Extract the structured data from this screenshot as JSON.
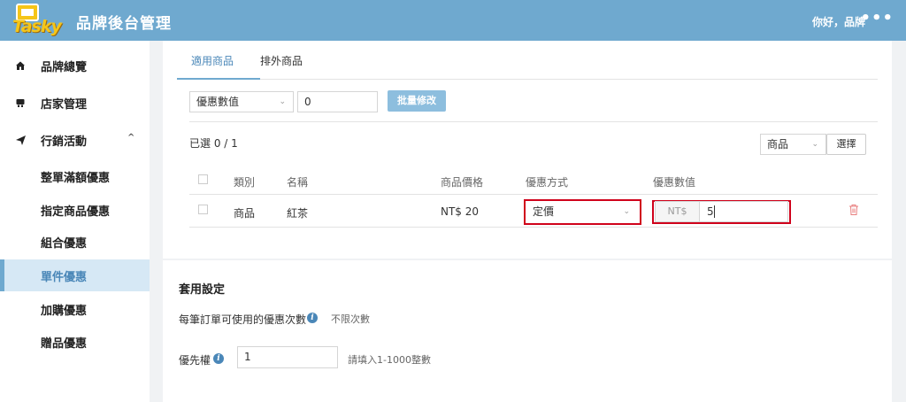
{
  "header": {
    "logo_text": "Tasky",
    "title": "品牌後台管理",
    "greeting": "你好，品牌",
    "more_label": "•••"
  },
  "sidebar": {
    "items": [
      {
        "label": "品牌總覽",
        "icon": "home-icon"
      },
      {
        "label": "店家管理",
        "icon": "store-icon"
      },
      {
        "label": "行銷活動",
        "icon": "send-icon",
        "expanded": true,
        "chevron": "^"
      },
      {
        "label": "整單滿額優惠"
      },
      {
        "label": "指定商品優惠"
      },
      {
        "label": "組合優惠"
      },
      {
        "label": "單件優惠",
        "active": true
      },
      {
        "label": "加購優惠"
      },
      {
        "label": "贈品優惠"
      }
    ]
  },
  "tabs": [
    {
      "label": "適用商品",
      "active": true
    },
    {
      "label": "排外商品"
    }
  ],
  "bulk": {
    "type_select": "優惠數值",
    "value_input": "0",
    "apply_button": "批量修改"
  },
  "selection": {
    "count_text": "已選 0 / 1",
    "filter_select": "商品",
    "choose_button": "選擇"
  },
  "table": {
    "columns": [
      "類別",
      "名稱",
      "商品價格",
      "優惠方式",
      "優惠數值"
    ],
    "rows": [
      {
        "category": "商品",
        "name": "紅茶",
        "price": "NT$ 20",
        "method": "定價",
        "value_prefix": "NT$",
        "value": "5"
      }
    ]
  },
  "settings": {
    "title": "套用設定",
    "usage_label": "每筆訂單可使用的優惠次數",
    "usage_value": "不限次數",
    "priority_label": "優先權",
    "priority_value": "1",
    "priority_hint": "請填入1-1000整數"
  },
  "colors": {
    "header_bg": "#6fa9cf",
    "accent": "#4a87b8",
    "highlight_frame": "#d0021b",
    "primary_button": "#8dbede"
  }
}
